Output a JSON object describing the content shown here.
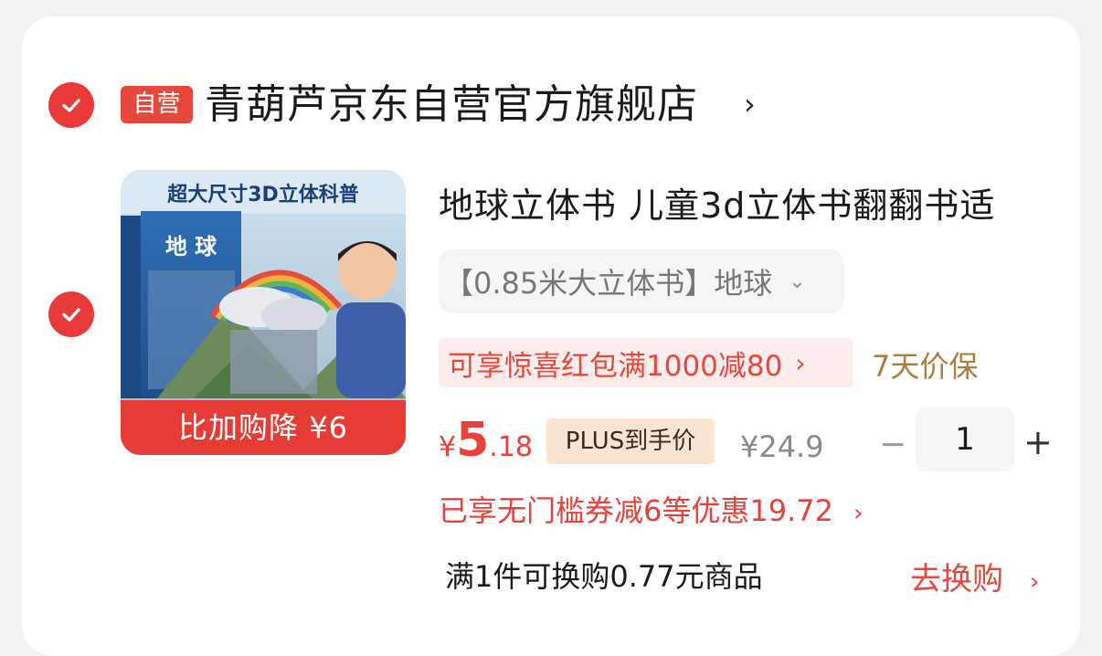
{
  "colors": {
    "accent": "#e8473c",
    "price": "#e8403a",
    "guarantee": "#b07a3a"
  },
  "store": {
    "badge": "自营",
    "name": "青葫芦京东自营官方旗舰店",
    "chevron": "›"
  },
  "product": {
    "image_banner": "比加购降 ¥6",
    "image_headline": "超大尺寸3D立体科普",
    "image_book_title": "地 球",
    "title": "地球立体书 儿童3d立体书翻翻书适",
    "spec": "【0.85米大立体书】地球",
    "promo": "可享惊喜红包满1000减80",
    "guarantee": "7天价保",
    "price_currency": "¥",
    "price_integer": "5",
    "price_decimal": ".18",
    "plus_label": "PLUS到手价",
    "original_price": "¥24.9",
    "quantity": "1",
    "discount": "已享无门槛券减6等优惠19.72",
    "exchange_text": "满1件可换购0.77元商品",
    "exchange_link": "去换购"
  }
}
